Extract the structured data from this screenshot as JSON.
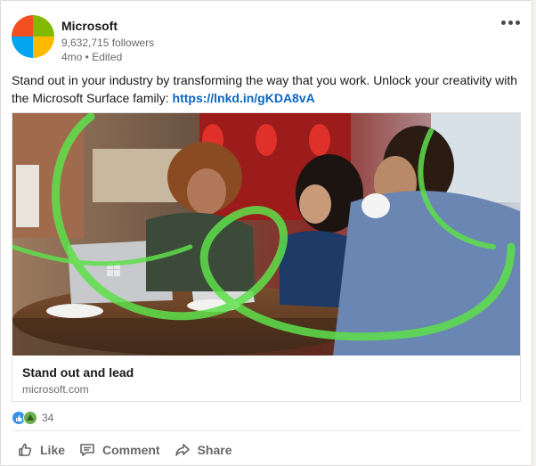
{
  "post": {
    "company_name": "Microsoft",
    "followers": "9,632,715 followers",
    "meta": "4mo • Edited",
    "text_before_link": "Stand out in your industry by transforming the way that you work. Unlock your creativity with the Microsoft Surface family: ",
    "link_text": "https://lnkd.in/gKDA8vA",
    "more_icon": "ellipsis-icon"
  },
  "preview": {
    "title": "Stand out and lead",
    "domain": "microsoft.com"
  },
  "reactions": {
    "icons": [
      "like-icon",
      "support-icon"
    ],
    "count": "34"
  },
  "actions": [
    {
      "label": "Like",
      "icon": "thumbs-up-icon"
    },
    {
      "label": "Comment",
      "icon": "comment-icon"
    },
    {
      "label": "Share",
      "icon": "share-icon"
    }
  ],
  "colors": {
    "logo_red": "#f25022",
    "logo_green": "#7fba00",
    "logo_blue": "#00a4ef",
    "logo_yellow": "#ffb900",
    "link": "#0a66c2",
    "like_blue": "#378fe9",
    "swirl_green": "#5ee04a"
  }
}
